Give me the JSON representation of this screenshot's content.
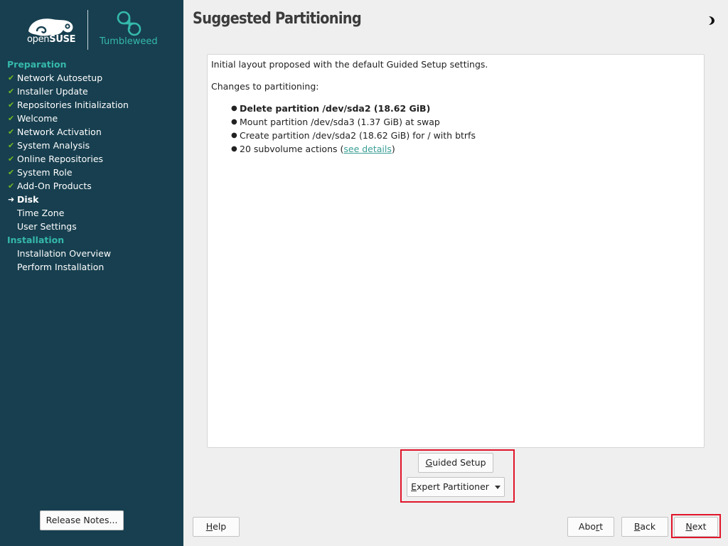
{
  "brand": {
    "opensuse": "open",
    "opensuse_bold": "SUSE",
    "tumbleweed": "Tumbleweed"
  },
  "sidebar": {
    "sections": [
      {
        "heading": "Preparation",
        "steps": [
          {
            "label": "Network Autosetup",
            "status": "done"
          },
          {
            "label": "Installer Update",
            "status": "done"
          },
          {
            "label": "Repositories Initialization",
            "status": "done"
          },
          {
            "label": "Welcome",
            "status": "done"
          },
          {
            "label": "Network Activation",
            "status": "done"
          },
          {
            "label": "System Analysis",
            "status": "done"
          },
          {
            "label": "Online Repositories",
            "status": "done"
          },
          {
            "label": "System Role",
            "status": "done"
          },
          {
            "label": "Add-On Products",
            "status": "done"
          },
          {
            "label": "Disk",
            "status": "current"
          },
          {
            "label": "Time Zone",
            "status": "pending"
          },
          {
            "label": "User Settings",
            "status": "pending"
          }
        ]
      },
      {
        "heading": "Installation",
        "steps": [
          {
            "label": "Installation Overview",
            "status": "pending"
          },
          {
            "label": "Perform Installation",
            "status": "pending"
          }
        ]
      }
    ],
    "release_notes": "Release Notes..."
  },
  "header": {
    "title": "Suggested Partitioning",
    "theme_icon": "moon-icon"
  },
  "content": {
    "intro": "Initial layout proposed with the default Guided Setup settings.",
    "changes_heading": "Changes to partitioning:",
    "changes": [
      {
        "text": "Delete partition /dev/sda2 (18.62 GiB)",
        "bold": true
      },
      {
        "text": "Mount partition /dev/sda3 (1.37 GiB) at swap",
        "bold": false
      },
      {
        "text": "Create partition /dev/sda2 (18.62 GiB) for / with btrfs",
        "bold": false
      }
    ],
    "subvolume_prefix": "20 subvolume actions (",
    "subvolume_link": "see details",
    "subvolume_suffix": ")"
  },
  "actions": {
    "guided_setup": {
      "mnemonic": "G",
      "rest": "uided Setup"
    },
    "expert_partitioner": {
      "mnemonic": "E",
      "rest": "xpert Partitioner"
    }
  },
  "footer": {
    "help": {
      "mnemonic": "H",
      "rest": "elp"
    },
    "abort": {
      "pre": "Abo",
      "mnemonic": "r",
      "rest": "t"
    },
    "back": {
      "mnemonic": "B",
      "rest": "ack"
    },
    "next": {
      "mnemonic": "N",
      "rest": "ext"
    }
  },
  "colors": {
    "sidebar_bg": "#173f4f",
    "accent": "#35b9ab",
    "check": "#73ba25",
    "highlight": "#e0152a"
  }
}
